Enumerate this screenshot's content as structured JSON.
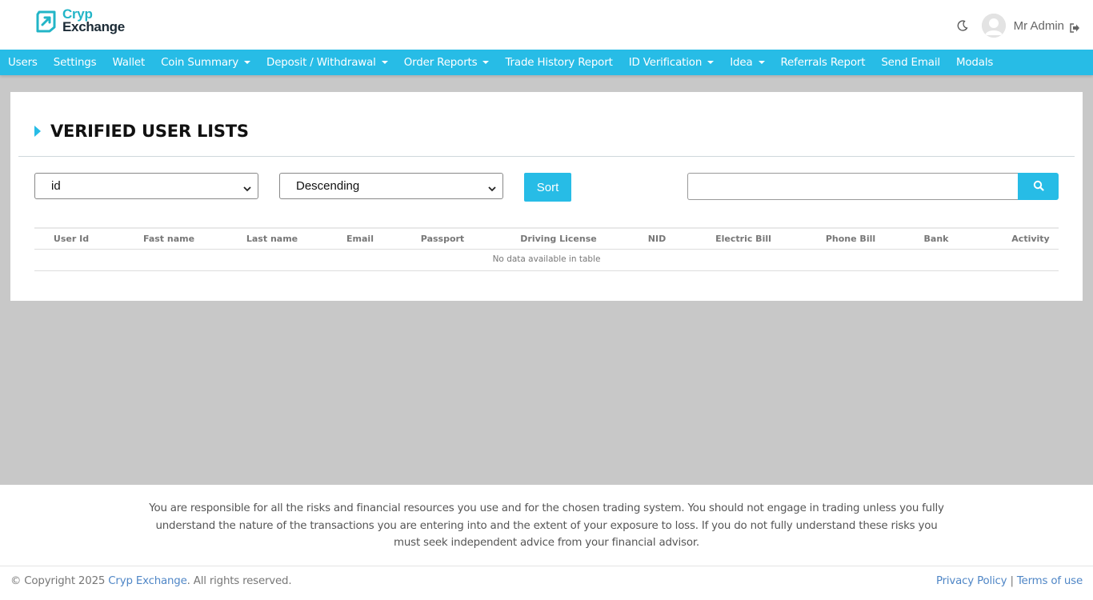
{
  "brand": {
    "line1": "Cryp",
    "line2": "Exchange"
  },
  "header": {
    "user_name": "Mr Admin"
  },
  "nav": [
    {
      "label": "Users",
      "dropdown": false
    },
    {
      "label": "Settings",
      "dropdown": false
    },
    {
      "label": "Wallet",
      "dropdown": false
    },
    {
      "label": "Coin Summary",
      "dropdown": true
    },
    {
      "label": "Deposit / Withdrawal",
      "dropdown": true
    },
    {
      "label": "Order Reports",
      "dropdown": true
    },
    {
      "label": "Trade History Report",
      "dropdown": false
    },
    {
      "label": "ID Verification",
      "dropdown": true
    },
    {
      "label": "Idea",
      "dropdown": true
    },
    {
      "label": "Referrals Report",
      "dropdown": false
    },
    {
      "label": "Send Email",
      "dropdown": false
    },
    {
      "label": "Modals",
      "dropdown": false
    }
  ],
  "page": {
    "title": "VERIFIED USER LISTS",
    "sort_field": "id",
    "sort_order": "Descending",
    "sort_button": "Sort",
    "search_value": ""
  },
  "table": {
    "columns": [
      "User Id",
      "Fast name",
      "Last name",
      "Email",
      "Passport",
      "Driving License",
      "NID",
      "Electric Bill",
      "Phone Bill",
      "Bank",
      "Activity"
    ],
    "empty_message": "No data available in table"
  },
  "footer": {
    "disclaimer": "You are responsible for all the risks and financial resources you use and for the chosen trading system. You should not engage in trading unless you fully understand the nature of the transactions you are entering into and the extent of your exposure to loss. If you do not fully understand these risks you must seek independent advice from your financial advisor.",
    "copyright_prefix": "© Copyright 2025 ",
    "copyright_brand": "Cryp Exchange",
    "copyright_suffix": ". All rights reserved.",
    "privacy_label": "Privacy Policy",
    "separator": " | ",
    "terms_label": "Terms of use"
  },
  "colors": {
    "accent": "#27bce6",
    "brand_teal": "#22b5c7",
    "link": "#4f86c6",
    "background": "#c8c8c8"
  }
}
